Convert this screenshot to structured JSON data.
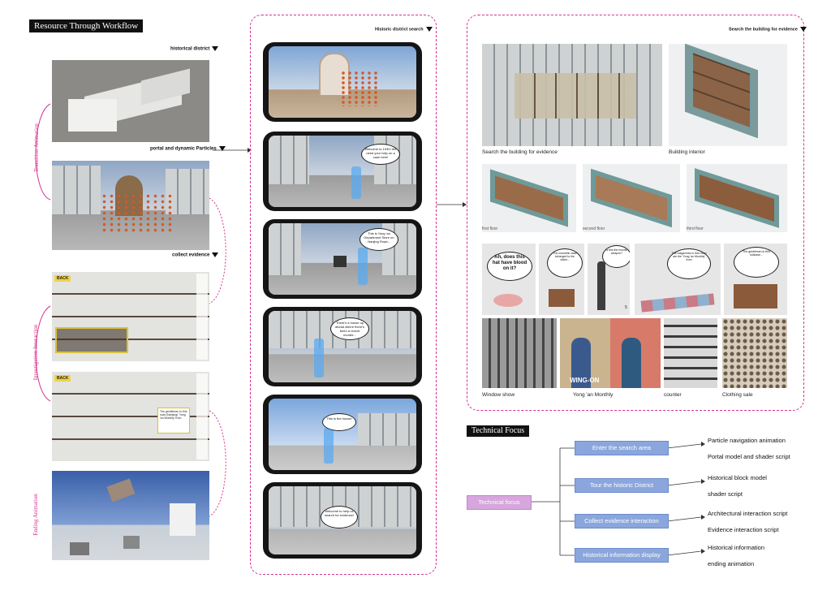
{
  "header": {
    "title": "Resource Through Workflow"
  },
  "left": {
    "label_historical": "historical district",
    "label_portal": "portal and dynamic Particles",
    "label_collect": "collect evidence",
    "side_transition": "Transition Animation",
    "side_investigation": "Investigation Interaction",
    "side_ending": "Ending Animation",
    "ui_back": "BACK",
    "ui_side_items": [
      "Scale",
      "Slice",
      "Collect",
      "Info"
    ],
    "speech_left": "The gentlemen in this road (Nanjing) 'Yong 'an Monthly' from"
  },
  "middle": {
    "label": "Historic district search",
    "bubbles": [
      "Welcome to 1930! We need your help on a case here!",
      "This is Yong 'an Department Store on Nanjing Road...",
      "There's a house up ahead where there's been a recent murder...",
      "This is the house!",
      "Welcome to help us search for evidence!"
    ]
  },
  "right": {
    "label": "Search the building for evidence",
    "caption_facade": "Search the building for evidence",
    "caption_interior": "Building interior",
    "floor_captions": [
      "first floor",
      "second floor",
      "third floor"
    ],
    "evidence_bubbles": [
      "Ah, does this hat have blood on it?",
      "The cosmetic case belonged to the victim...",
      "Is this the murder weapon?",
      "The magazines in this room are the 'Yong 'an Monthly' from",
      "The gentlemen in this suitcase..."
    ],
    "evidence_number": "5",
    "photo_captions": [
      "Window show",
      "Yong 'an Monthly",
      "counter",
      "Clothing sale"
    ],
    "poster_text": "WING-ON"
  },
  "technical": {
    "title": "Technical Focus",
    "root": "Technical focus",
    "steps": [
      {
        "label": "Enter the search area",
        "outputs": [
          "Particle navigation animation",
          "Portal model and shader script"
        ]
      },
      {
        "label": "Tour the historic District",
        "outputs": [
          "Historical block model",
          "shader script"
        ]
      },
      {
        "label": "Collect evidence interaction",
        "outputs": [
          "Architectural interaction script",
          "Evidence interaction script"
        ]
      },
      {
        "label": "Historical information display",
        "outputs": [
          "Historical information",
          "ending animation"
        ]
      }
    ]
  },
  "colors": {
    "accent_pink": "#d6338f",
    "step_blue": "#8aa6dc",
    "root_pink": "#d6a6dc"
  }
}
